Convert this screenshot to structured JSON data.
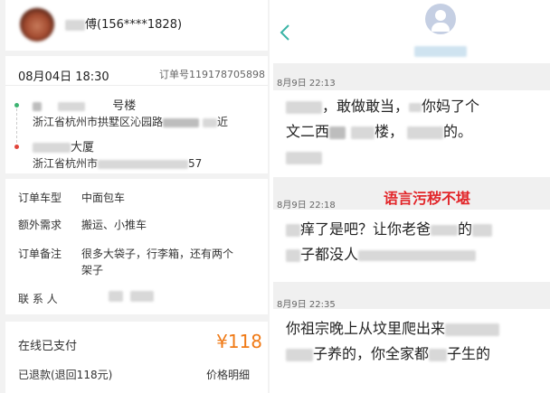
{
  "order": {
    "driver_name": "傅(156****1828)",
    "datetime": "08月04日 18:30",
    "order_no": "订单号119178705898",
    "from_title": "号楼",
    "from_addr": "浙江省杭州市拱墅区沁园路",
    "from_near": "近",
    "to_title": "大厦",
    "to_addr": "浙江省杭州市",
    "to_addr_tail": "57",
    "fields": [
      {
        "label": "订单车型",
        "value": "中面包车"
      },
      {
        "label": "额外需求",
        "value": "搬运、小推车"
      },
      {
        "label": "订单备注",
        "value": "很多大袋子，行李箱，还有两个"
      },
      {
        "label": "联 系 人",
        "value": ""
      }
    ],
    "remark_line2": "架子",
    "paid_label": "在线已支付",
    "price": "¥118",
    "refund": "已退款(退回118元)",
    "price_detail": "价格明细"
  },
  "chat": {
    "back_icon": "chevron-left-icon",
    "messages": [
      {
        "time": "8月9日  22:13",
        "line1": "，敢做敢当，",
        "line1b": "你妈了个",
        "line2": "文二西",
        "line2b": "楼，",
        "line2c": "的。"
      },
      {
        "time": "8月9日  22:18",
        "line1": "痒了是吧？让你老爸",
        "line1b": "的",
        "line2": "子都没人"
      },
      {
        "time": "8月9日  22:35",
        "line1": "你祖宗晚上从坟里爬出来",
        "line1b": "",
        "line2": "子养的，你全家都",
        "line2b": "子生的"
      }
    ],
    "warning": "语言污秽不堪"
  },
  "colors": {
    "accent_orange": "#f07a16",
    "warning_red": "#e2262a",
    "green_dot": "#3cb371",
    "red_dot": "#e0443a",
    "back_teal": "#3ab4a6"
  }
}
